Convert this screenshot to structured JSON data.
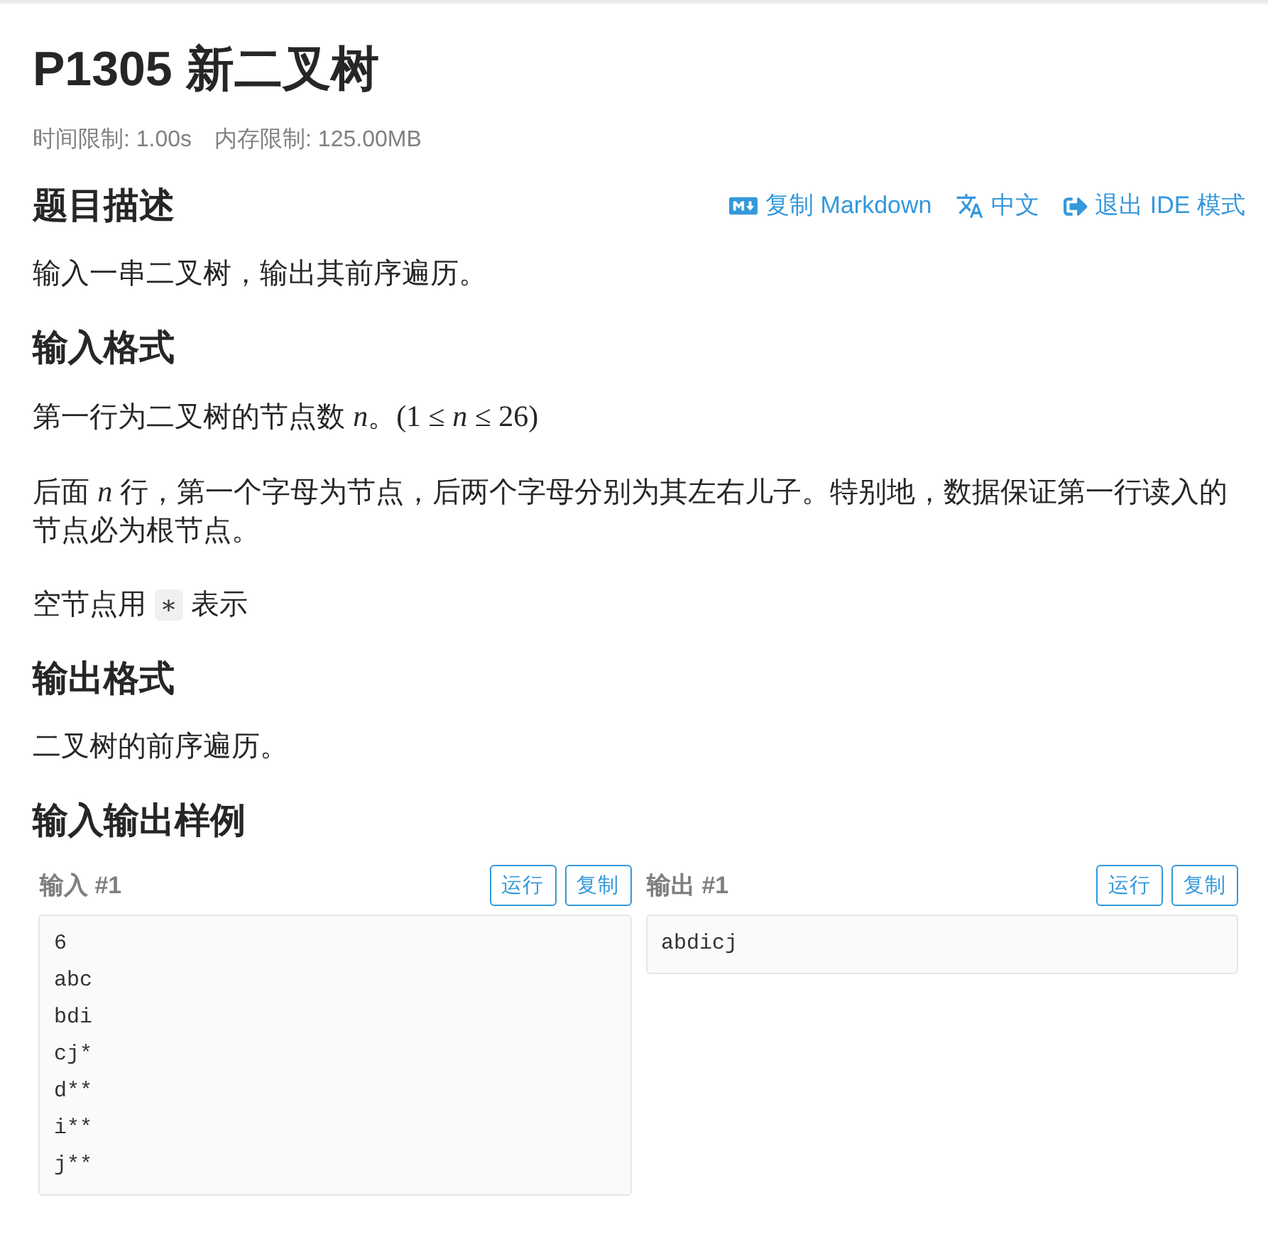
{
  "title": "P1305 新二叉树",
  "limits": [
    "时间限制: 1.00s",
    "内存限制: 125.00MB"
  ],
  "sections": [
    {
      "heading": "题目描述",
      "actions": [
        {
          "kind": "markdown",
          "label": "复制 Markdown"
        },
        {
          "kind": "translate",
          "label": "中文"
        },
        {
          "kind": "exit",
          "label": "退出 IDE 模式"
        }
      ],
      "paragraphs": [
        {
          "parts": [
            {
              "kind": "text",
              "text": "输入一串二叉树，输出其前序遍历。"
            }
          ]
        }
      ]
    },
    {
      "heading": "输入格式",
      "paragraphs": [
        {
          "parts": [
            {
              "kind": "text",
              "text": "第一行为二叉树的节点数 "
            },
            {
              "kind": "math",
              "text": "*n*"
            },
            {
              "kind": "text",
              "text": "。"
            },
            {
              "kind": "math",
              "text": "(1 ≤ *n* ≤ 26)"
            }
          ]
        },
        {
          "parts": [
            {
              "kind": "text",
              "text": "后面 "
            },
            {
              "kind": "math",
              "text": "*n*"
            },
            {
              "kind": "text",
              "text": " 行，第一个字母为节点，后两个字母分别为其左右儿子。特别地，数据保证第一行读入的节点必为根节点。"
            }
          ]
        },
        {
          "parts": [
            {
              "kind": "text",
              "text": "空节点用 "
            },
            {
              "kind": "code",
              "text": "∗"
            },
            {
              "kind": "text",
              "text": " 表示"
            }
          ]
        }
      ]
    },
    {
      "heading": "输出格式",
      "paragraphs": [
        {
          "parts": [
            {
              "kind": "text",
              "text": "二叉树的前序遍历。"
            }
          ]
        }
      ]
    }
  ],
  "samples": {
    "heading": "输入输出样例",
    "items": [
      {
        "title": "输入 #1",
        "buttons": [
          "运行",
          "复制"
        ],
        "lines": [
          "6",
          "abc",
          "bdi",
          "cj*",
          "d**",
          "i**",
          "j**"
        ]
      },
      {
        "title": "输出 #1",
        "buttons": [
          "运行",
          "复制"
        ],
        "lines": [
          "abdicj"
        ]
      }
    ]
  }
}
